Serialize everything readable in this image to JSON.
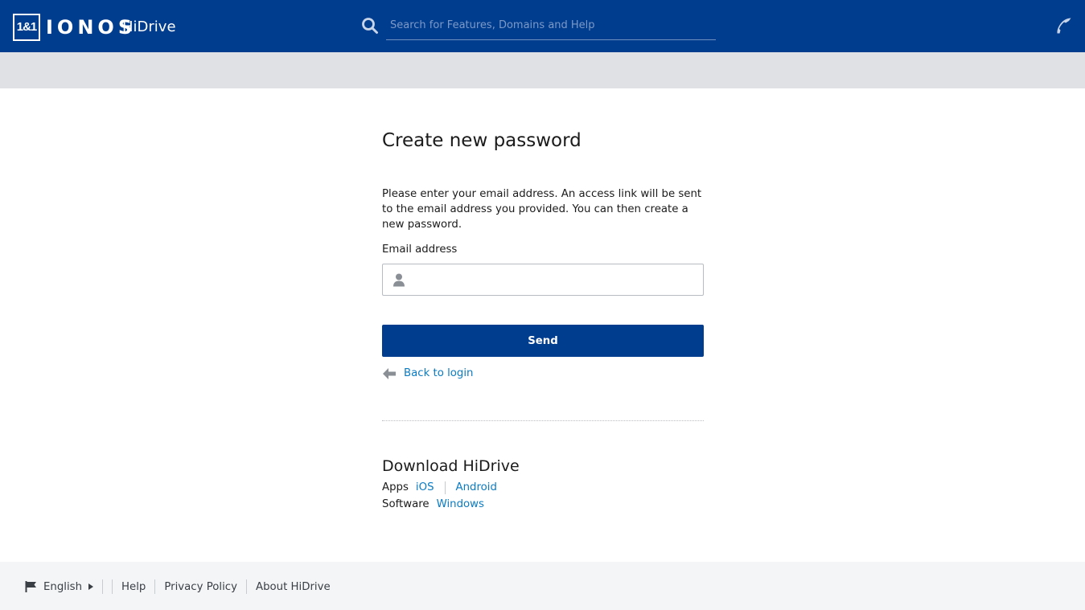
{
  "header": {
    "logo_box": "1&1",
    "logo_word": "IONOS",
    "product": "HiDrive",
    "search_placeholder": "Search for Features, Domains and Help",
    "search_value": ""
  },
  "main": {
    "title": "Create new password",
    "intro": "Please enter your email address. An access link will be sent to the email address you provided. You can then create a new password.",
    "email_label": "Email address",
    "email_value": "",
    "send_label": "Send",
    "back_label": "Back to login"
  },
  "download": {
    "title": "Download HiDrive",
    "apps_label": "Apps",
    "apps": [
      "iOS",
      "Android"
    ],
    "software_label": "Software",
    "software": [
      "Windows"
    ]
  },
  "footer": {
    "language": "English",
    "links": [
      "Help",
      "Privacy Policy",
      "About HiDrive"
    ]
  },
  "colors": {
    "brand_blue": "#003d8f",
    "link_blue": "#0b7bc2",
    "subbar_gray": "#dfe1e5",
    "footer_bg": "#f4f5f7"
  },
  "icons": {
    "search": "search-icon",
    "phone": "phone-icon",
    "user": "user-icon",
    "back": "arrow-left-icon",
    "language": "flag-icon",
    "caret": "caret-right-icon"
  }
}
